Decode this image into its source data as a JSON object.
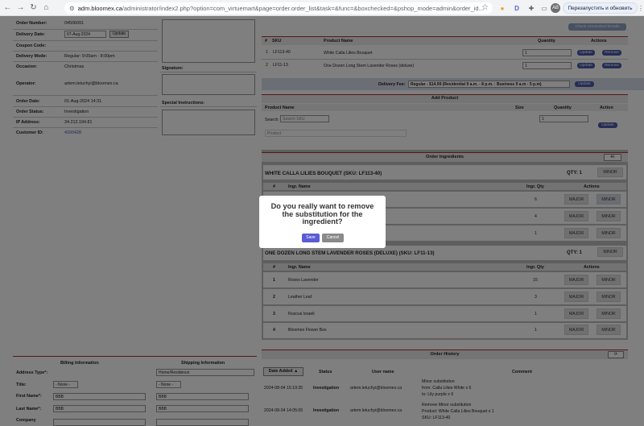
{
  "browser": {
    "url_host": "adm.bloomex.ca",
    "url_path": "/administrator/index2.php?option=com_virtuemart&page=order.order_list&task=&func=&boxchecked=&pshop_mode=admin&order_id...",
    "relaunch": "Перезапустить и обновить"
  },
  "order": {
    "number_label": "Order Number:",
    "number": "04506091",
    "delivery_date_label": "Delivery Date:",
    "delivery_date": "07-Aug-2024",
    "update": "Update",
    "coupon_label": "Coupon Code:",
    "delivery_mode_label": "Delivery Mode:",
    "delivery_mode": "Regular: 9:00am - 8:00pm",
    "occasion_label": "Occasion:",
    "occasion": "Christmas",
    "signature_label": "Signature:",
    "operator_label": "Operator:",
    "operator": "artem.letuchyi@bloomex.ca",
    "instructions_label": "Special Instructions:",
    "order_date_label": "Order Date:",
    "order_date": "01-Aug-2024 14:31",
    "status_label": "Order Status:",
    "status": "Investigation",
    "ip_label": "IP Address:",
    "ip": "34.212.194.81",
    "customer_label": "Customer ID:",
    "customer": "4160428"
  },
  "check_emails": "Check Unresolved Emails",
  "products": {
    "headers": [
      "#",
      "SKU",
      "Product Name",
      "Quantity",
      "Actions"
    ],
    "rows": [
      {
        "n": "1",
        "sku": "LF113-40",
        "name": "White Calla Lilies Bouquet",
        "qty": "1",
        "update": "Update",
        "remove": "Remove"
      },
      {
        "n": "2",
        "sku": "LF11-13",
        "name": "One Dozen Long Stem Lavender Roses (deluxe)",
        "qty": "1",
        "update": "Update",
        "remove": "Remove"
      }
    ]
  },
  "delivery_fee": {
    "label": "Delivery Fee:",
    "value": "Regular - $14.99 (Residential 9 a.m. - 8 p.m. : Business 9 a.m - 5 p.m)",
    "update": "Update"
  },
  "add_product": {
    "title": "Add Product",
    "headers": [
      "Product Name",
      "Size",
      "Quantity",
      "Action"
    ],
    "search_label": "Search:",
    "search_placeholder": "Search SKU",
    "product_placeholder": "Product",
    "qty": "1",
    "update": "Update"
  },
  "ingredients": {
    "title": "Order Ingredients",
    "toggle": "+/-",
    "groups": [
      {
        "title": "WHITE CALLA LILIES BOUQUET (SKU: LF113-40)",
        "qty_label": "QTY: 1",
        "minor": "MINOR",
        "headers": [
          "#",
          "Ingr. Name",
          "Ingr. Qty",
          "Actions"
        ],
        "rows": [
          {
            "n": "",
            "name": "",
            "qty": "6",
            "major": "MAJOR",
            "minor": "MINOR"
          },
          {
            "n": "",
            "name": "",
            "qty": "4",
            "major": "MAJOR",
            "minor": "MINOR"
          },
          {
            "n": "",
            "name": "",
            "qty": "1",
            "major": "MAJOR",
            "minor": "MINOR"
          }
        ]
      },
      {
        "title": "ONE DOZEN LONG STEM LAVENDER ROSES (DELUXE) (SKU: LF11-13)",
        "qty_label": "QTY: 1",
        "minor": "MINOR",
        "headers": [
          "#",
          "Ingr. Name",
          "Ingr. Qty",
          "Actions"
        ],
        "rows": [
          {
            "n": "1",
            "name": "Roses Lavender",
            "qty": "15",
            "major": "MAJOR",
            "minor": "MINOR"
          },
          {
            "n": "2",
            "name": "Leather Leaf",
            "qty": "3",
            "major": "MAJOR",
            "minor": "MINOR"
          },
          {
            "n": "3",
            "name": "Ruscus Israeli",
            "qty": "1",
            "major": "MAJOR",
            "minor": "MINOR"
          },
          {
            "n": "4",
            "name": "Bloomex Flower Box",
            "qty": "1",
            "major": "MAJOR",
            "minor": "MINOR"
          }
        ]
      }
    ]
  },
  "billing": {
    "title": "Billing Information",
    "shipping_title": "Shipping Information",
    "address_type_label": "Address Type*:",
    "address_type": "Home/Residence",
    "title_label": "Title:",
    "title_value": "- None -",
    "first_label": "First Name*:",
    "first": "BBB",
    "last_label": "Last Name*:",
    "last": "BBB",
    "company_label": "Company",
    "ship_first": "BBB",
    "ship_last": "BBB"
  },
  "history": {
    "title": "Order History",
    "headers": [
      "Date Added ▲",
      "Status",
      "User name",
      "Comment"
    ],
    "rows": [
      {
        "date": "2024-08-04 15:19:35",
        "status": "Investigation",
        "user": "artem.letuchyi@bloomex.ca",
        "comment1": "Minor substitution",
        "comment2": "from: Calla Lilies White x 6",
        "comment3": "to:   Lily purple x 6"
      },
      {
        "date": "2024-08-04 14:05:05",
        "status": "Investigation",
        "user": "artem.letuchyi@bloomex.ca",
        "comment1": "Remove Minor substitution",
        "comment2": "Product: White Calla Lilies Bouquet x 1",
        "comment3": "SKU: LF113-40"
      }
    ]
  },
  "modal": {
    "question": "Do you really want to remove the substitution for the ingredient?",
    "save": "Save",
    "cancel": "Cancel",
    "save_color": "#5b5bd6",
    "cancel_color": "#8a8a8a"
  }
}
